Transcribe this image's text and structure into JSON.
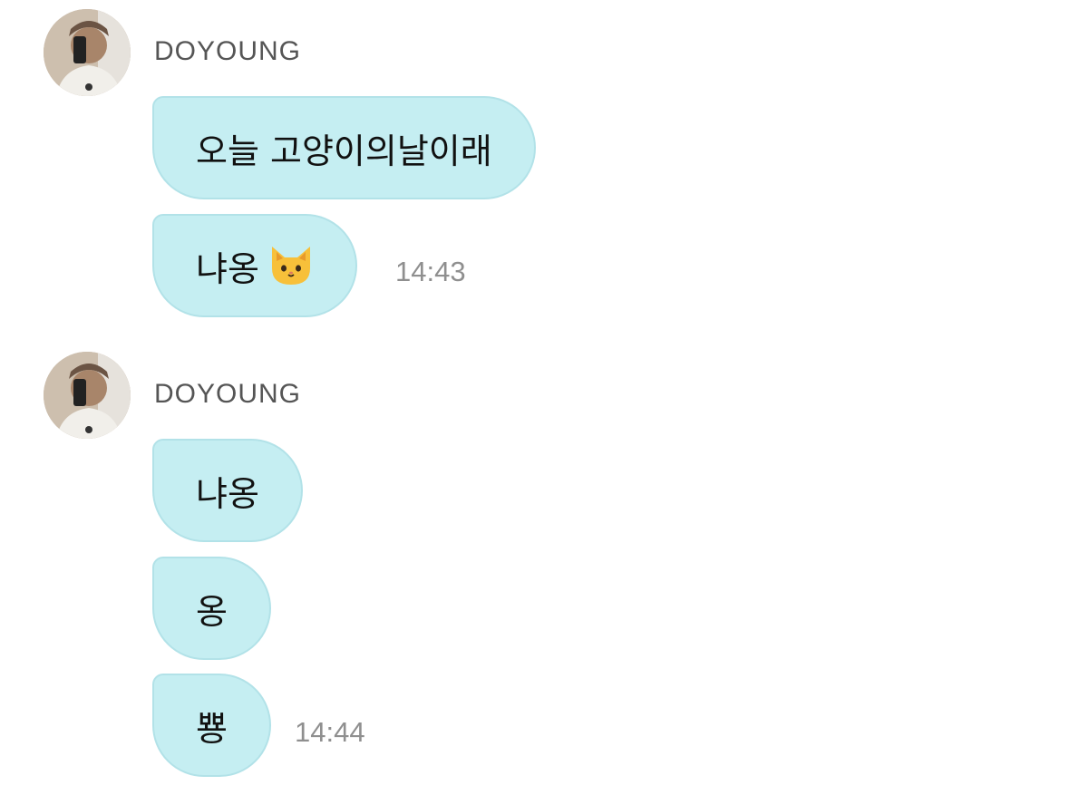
{
  "colors": {
    "bubble_bg": "#c5eef2",
    "bubble_border": "#b2e2e8",
    "sender_text": "#555555",
    "time_text": "#8f8f8f"
  },
  "groups": [
    {
      "sender": "DOYOUNG",
      "avatar_icon": "avatar-photo",
      "messages": [
        {
          "text": "오늘 고양이의날이래"
        },
        {
          "text": "냐옹",
          "emoji": "cat-face-icon",
          "time": "14:43"
        }
      ]
    },
    {
      "sender": "DOYOUNG",
      "avatar_icon": "avatar-photo",
      "messages": [
        {
          "text": "냐옹"
        },
        {
          "text": "옹"
        },
        {
          "text": "뿅",
          "time": "14:44"
        }
      ]
    }
  ]
}
